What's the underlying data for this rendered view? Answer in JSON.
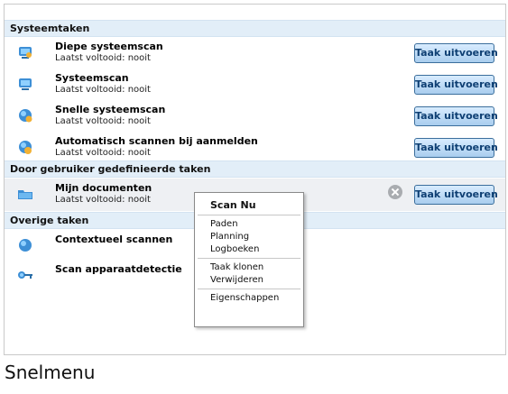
{
  "sections": [
    {
      "id": "system",
      "label": "Systeemtaken"
    },
    {
      "id": "user",
      "label": "Door gebruiker gedefinieerde taken"
    },
    {
      "id": "other",
      "label": "Overige taken"
    }
  ],
  "system_tasks": [
    {
      "title": "Diepe systeemscan",
      "status": "Laatst voltooid: nooit",
      "icon": "deep-scan-icon"
    },
    {
      "title": "Systeemscan",
      "status": "Laatst voltooid: nooit",
      "icon": "system-scan-icon"
    },
    {
      "title": "Snelle systeemscan",
      "status": "Laatst voltooid: nooit",
      "icon": "quick-scan-icon"
    },
    {
      "title": "Automatisch scannen bij aanmelden",
      "status": "Laatst voltooid: nooit",
      "icon": "auto-scan-icon"
    }
  ],
  "user_tasks": [
    {
      "title": "Mijn documenten",
      "status": "Laatst voltooid: nooit",
      "icon": "folder-scan-icon"
    }
  ],
  "other_tasks": [
    {
      "title": "Contextueel scannen",
      "icon": "context-scan-icon"
    },
    {
      "title": "Scan apparaatdetectie",
      "icon": "device-scan-icon"
    }
  ],
  "run_button_label": "Taak uitvoeren",
  "context_menu": {
    "default_item": "Scan Nu",
    "group1": [
      "Paden",
      "Planning",
      "Logboeken"
    ],
    "group2": [
      "Taak klonen",
      "Verwijderen"
    ],
    "group3": [
      "Eigenschappen"
    ]
  },
  "caption": "Snelmenu",
  "colors": {
    "header_bg": "#e2eef8",
    "button_text": "#0e3f73",
    "button_border": "#3b6e9c",
    "selected_row": "#eef0f3"
  }
}
